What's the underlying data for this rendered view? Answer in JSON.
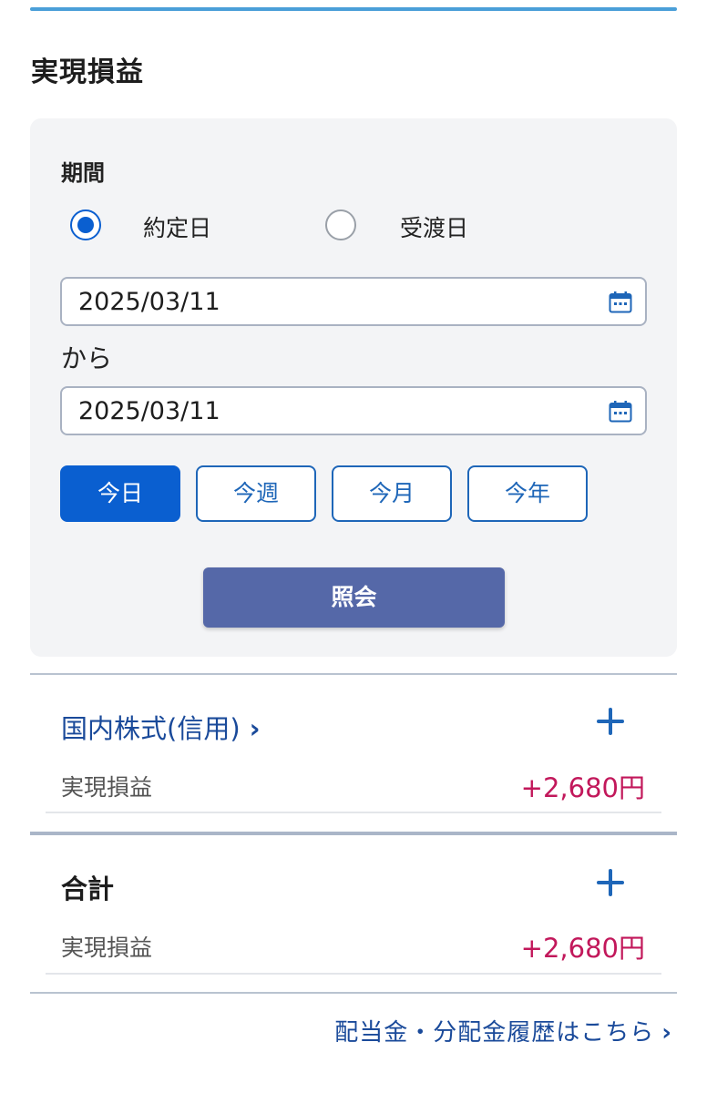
{
  "header": {
    "title": "実現損益",
    "accent_color": "#4a9fd8"
  },
  "filter": {
    "period_label": "期間",
    "date_types": [
      {
        "label": "約定日",
        "checked": true
      },
      {
        "label": "受渡日",
        "checked": false
      }
    ],
    "from_date": "2025/03/11",
    "separator_label": "から",
    "to_date": "2025/03/11",
    "quick_ranges": [
      {
        "label": "今日",
        "active": true
      },
      {
        "label": "今週",
        "active": false
      },
      {
        "label": "今月",
        "active": false
      },
      {
        "label": "今年",
        "active": false
      }
    ],
    "submit_label": "照会"
  },
  "sections": [
    {
      "title": "国内株式(信用)",
      "chevron": "›",
      "row_label": "実現損益",
      "row_value": "+2,680円"
    },
    {
      "title": "合計",
      "row_label": "実現損益",
      "row_value": "+2,680円"
    }
  ],
  "footer": {
    "link_label": "配当金・分配金履歴はこちら",
    "chevron": "›"
  },
  "colors": {
    "primary": "#0a5fd0",
    "link": "#1a4a9a",
    "profit": "#c2185b",
    "submit": "#5568a8"
  }
}
